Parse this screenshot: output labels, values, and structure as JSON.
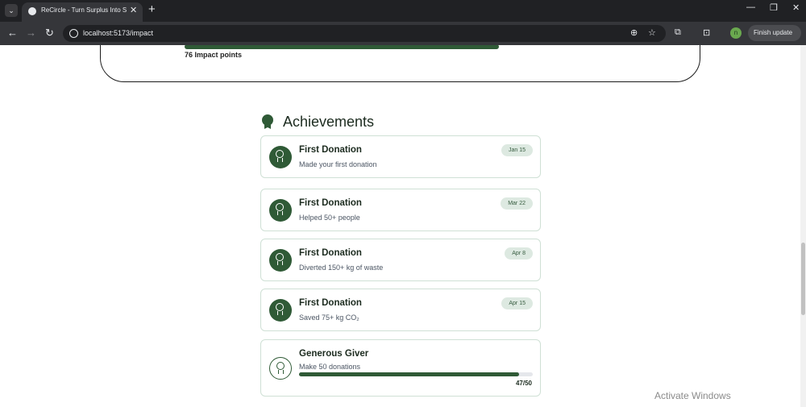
{
  "browser": {
    "tab_title": "ReCircle - Turn Surplus Into Su",
    "url": "localhost:5173/impact",
    "finish_update": "Finish update",
    "profile_initial": "n"
  },
  "impact": {
    "points_label": "76 Impact points"
  },
  "achievements": {
    "heading": "Achievements",
    "items": [
      {
        "title": "First Donation",
        "desc": "Made your first donation",
        "date": "Jan 15"
      },
      {
        "title": "First Donation",
        "desc": "Helped 50+ people",
        "date": "Mar 22"
      },
      {
        "title": "First Donation",
        "desc": "Diverted 150+ kg of waste",
        "date": "Apr 8"
      },
      {
        "title": "First Donation",
        "desc": "Saved 75+ kg CO₂",
        "date": "Apr 15"
      }
    ],
    "in_progress": {
      "title": "Generous Giver",
      "desc": "Make 50 donations",
      "progress_text": "47/50",
      "progress_fraction": 0.94
    }
  },
  "windows_watermark": "Activate Windows",
  "colors": {
    "accent": "#2f5a36",
    "pill_bg": "#dde9e1",
    "card_border": "#cfe0d5"
  }
}
